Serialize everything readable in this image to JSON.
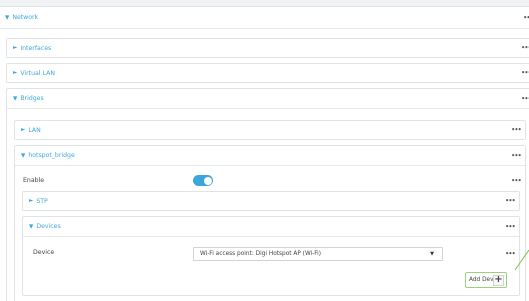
{
  "colors": {
    "accent": "#3fa7de",
    "callout": "#7bc04d"
  },
  "network": {
    "title": "Network"
  },
  "interfaces": {
    "title": "Interfaces"
  },
  "virtual_lan": {
    "title": "Virtual LAN"
  },
  "bridges": {
    "title": "Bridges"
  },
  "lan": {
    "title": "LAN"
  },
  "hotspot_bridge": {
    "title": "hotspot_bridge",
    "enable_label": "Enable",
    "enable_on": true
  },
  "stp": {
    "title": "STP"
  },
  "devices": {
    "title": "Devices",
    "device_label": "Device",
    "device_value": "Wi-Fi access point: Digi Hotspot AP (Wi-Fi)",
    "add_label": "Add Device"
  },
  "menu_glyph": "•••"
}
